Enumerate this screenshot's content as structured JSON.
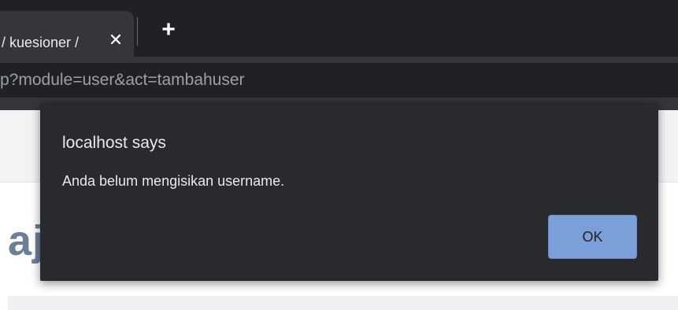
{
  "browser": {
    "tab": {
      "title": "/ kuesioner /",
      "close_icon": "close-icon"
    },
    "new_tab_icon": "plus-icon",
    "address_bar": {
      "url": "p?module=user&act=tambahuser"
    }
  },
  "page": {
    "heading_fragment": "aj"
  },
  "dialog": {
    "title": "localhost says",
    "message": "Anda belum mengisikan username.",
    "ok_label": "OK"
  },
  "colors": {
    "tabbar_bg": "#202124",
    "toolbar_bg": "#35363a",
    "dialog_bg": "#292a2d",
    "ok_button_bg": "#7ba0d9"
  }
}
